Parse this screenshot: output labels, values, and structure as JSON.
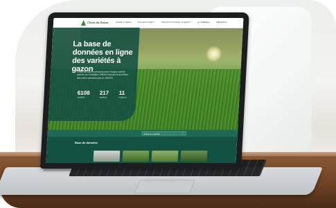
{
  "site": {
    "logo_text": "Choix du Gazon",
    "nav": [
      "Choisir un gazon",
      "Comment choisir ?",
      "Comment est évalué un gazon ?",
      "Le Catalogue",
      "Nos actions"
    ]
  },
  "hero": {
    "title": "La base de données en ligne des variétés à gazon",
    "description": "Choix du Gazon présente pour chaque variété inscrite au Catalogue Officiel français la synthèse des notes calculées par le GEVES",
    "stats": [
      {
        "value": "6108",
        "label": "Variétés"
      },
      {
        "value": "217",
        "label": "Variétés"
      },
      {
        "value": "11",
        "label": "Espèces"
      }
    ]
  },
  "search": {
    "placeholder": "Saisir un variété"
  },
  "section": {
    "title": "Base de données"
  },
  "colors": {
    "brand_dark": "#135242",
    "brand_overlay": "#1e6a54",
    "grass": "#4e8a2c"
  }
}
